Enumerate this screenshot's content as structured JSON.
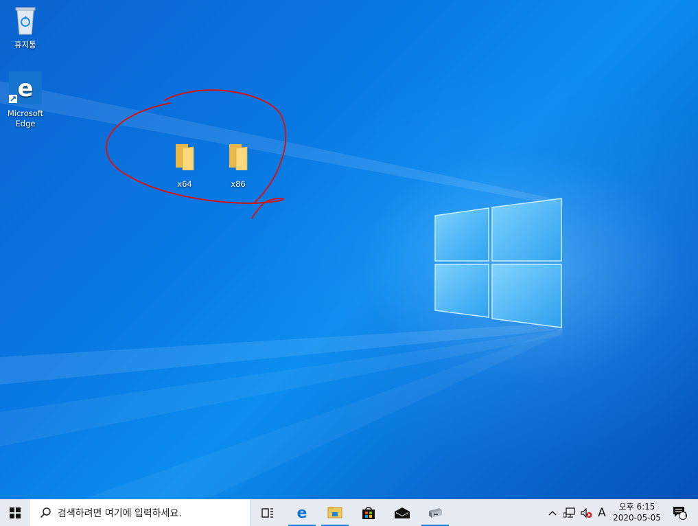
{
  "desktop": {
    "icons": [
      {
        "label": "휴지통",
        "icon": "recycle-bin-icon"
      },
      {
        "label_line1": "Microsoft",
        "label_line2": "Edge",
        "icon": "edge-icon"
      }
    ],
    "folders": [
      {
        "label": "x64",
        "icon": "folder-icon"
      },
      {
        "label": "x86",
        "icon": "folder-icon"
      }
    ]
  },
  "taskbar": {
    "search_placeholder": "검색하려면 여기에 입력하세요.",
    "pinned": [
      "task-view-icon",
      "edge-icon",
      "file-explorer-icon",
      "store-icon",
      "mail-icon",
      "network-app-icon"
    ],
    "tray": {
      "ime": "A",
      "time": "오후 6:15",
      "date": "2020-05-05",
      "notification_count": "1"
    }
  },
  "colors": {
    "desktop_accent": "#0a78e2",
    "annotation": "#d0161b",
    "taskbar_bg": "#e6ebf2",
    "active_indicator": "#1e7fd8"
  }
}
